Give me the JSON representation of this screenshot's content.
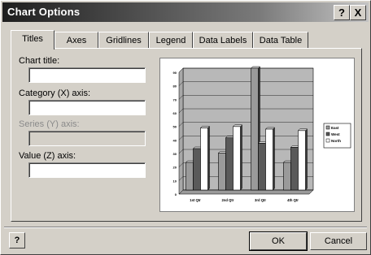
{
  "window": {
    "title": "Chart Options"
  },
  "titlebar_buttons": {
    "help": "?",
    "close": "X"
  },
  "tabs": [
    {
      "label": "Titles",
      "active": true
    },
    {
      "label": "Axes"
    },
    {
      "label": "Gridlines"
    },
    {
      "label": "Legend"
    },
    {
      "label": "Data Labels"
    },
    {
      "label": "Data Table"
    }
  ],
  "form": {
    "chart_title_label": "Chart title:",
    "chart_title_value": "",
    "category_axis_label": "Category (X) axis:",
    "category_axis_value": "",
    "series_axis_label": "Series (Y) axis:",
    "series_axis_value": "",
    "value_axis_label": "Value (Z) axis:",
    "value_axis_value": ""
  },
  "chart_data": {
    "type": "bar",
    "categories": [
      "1st Qtr",
      "2nd Qtr",
      "3rd Qtr",
      "4th Qtr"
    ],
    "series": [
      {
        "name": "East",
        "values": [
          20.4,
          27.4,
          90,
          20.4
        ]
      },
      {
        "name": "West",
        "values": [
          30.6,
          38.6,
          34.6,
          31.6
        ]
      },
      {
        "name": "North",
        "values": [
          45.9,
          46.9,
          45,
          43.9
        ]
      }
    ],
    "ylim": [
      0,
      90
    ],
    "yticks": [
      "0",
      "10",
      "20",
      "30",
      "40",
      "50",
      "60",
      "70",
      "80",
      "90"
    ],
    "legend_position": "right",
    "grid": true,
    "colors": {
      "East": "#9a9a9a",
      "West": "#5a5a5a",
      "North": "#ffffff",
      "wall": "#b8b8b8"
    }
  },
  "buttons": {
    "help": "?",
    "ok": "OK",
    "cancel": "Cancel"
  }
}
